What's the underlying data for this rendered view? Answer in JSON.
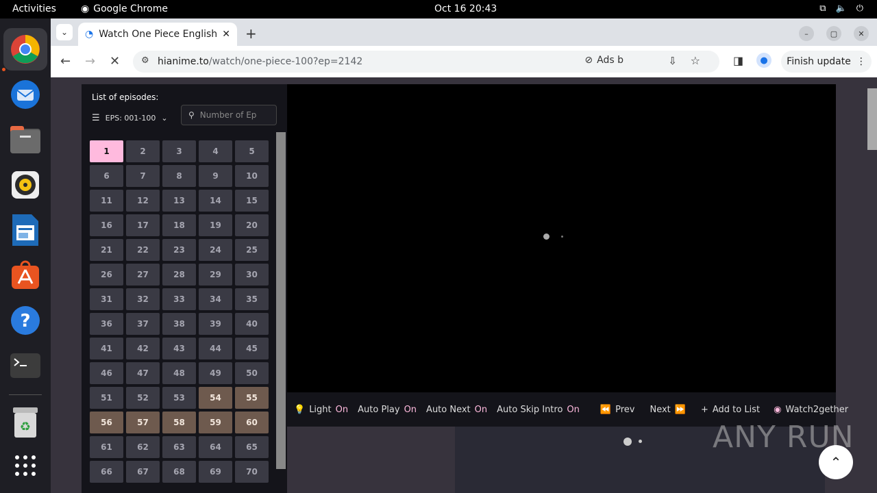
{
  "topbar": {
    "activities": "Activities",
    "app_name": "Google Chrome",
    "clock": "Oct 16  20:43"
  },
  "browser": {
    "tab_title": "Watch One Piece English",
    "url_host": "hianime.to",
    "url_path": "/watch/one-piece-100?ep=2142",
    "ads_label": "Ads b",
    "finish_update": "Finish update"
  },
  "episodes": {
    "header": "List of episodes:",
    "range": "EPS: 001-100",
    "search_placeholder": "Number of Ep",
    "active": "1",
    "items": [
      "1",
      "2",
      "3",
      "4",
      "5",
      "6",
      "7",
      "8",
      "9",
      "10",
      "11",
      "12",
      "13",
      "14",
      "15",
      "16",
      "17",
      "18",
      "19",
      "20",
      "21",
      "22",
      "23",
      "24",
      "25",
      "26",
      "27",
      "28",
      "29",
      "30",
      "31",
      "32",
      "33",
      "34",
      "35",
      "36",
      "37",
      "38",
      "39",
      "40",
      "41",
      "42",
      "43",
      "44",
      "45",
      "46",
      "47",
      "48",
      "49",
      "50",
      "51",
      "52",
      "53",
      "54",
      "55",
      "56",
      "57",
      "58",
      "59",
      "60",
      "61",
      "62",
      "63",
      "64",
      "65",
      "66",
      "67",
      "68",
      "69",
      "70"
    ],
    "watched": [
      "54",
      "55",
      "56",
      "57",
      "58",
      "59",
      "60"
    ]
  },
  "controls": {
    "light": "Light",
    "light_state": "On",
    "autoplay": "Auto Play",
    "autoplay_state": "On",
    "autonext": "Auto Next",
    "autonext_state": "On",
    "autoskip": "Auto Skip Intro",
    "autoskip_state": "On",
    "prev": "Prev",
    "next": "Next",
    "add_to_list": "Add to List",
    "watch2gether": "Watch2gether"
  },
  "watermark": "ANY RUN",
  "colors": {
    "accent": "#ffbade",
    "watched": "#6e5a4e"
  }
}
